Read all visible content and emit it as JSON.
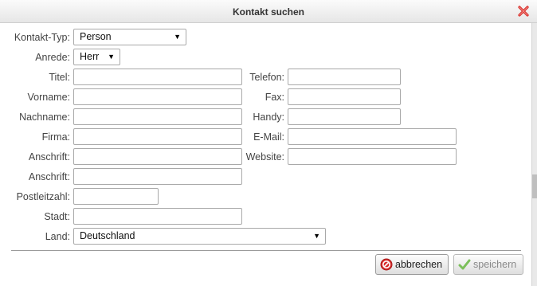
{
  "dialog": {
    "title": "Kontakt suchen"
  },
  "labels": {
    "kontakt_typ": "Kontakt-Typ:",
    "anrede": "Anrede:",
    "titel": "Titel:",
    "vorname": "Vorname:",
    "nachname": "Nachname:",
    "firma": "Firma:",
    "anschrift1": "Anschrift:",
    "anschrift2": "Anschrift:",
    "postleitzahl": "Postleitzahl:",
    "stadt": "Stadt:",
    "land": "Land:",
    "telefon": "Telefon:",
    "fax": "Fax:",
    "handy": "Handy:",
    "email": "E-Mail:",
    "website": "Website:"
  },
  "values": {
    "kontakt_typ": "Person",
    "anrede": "Herr",
    "land": "Deutschland",
    "titel": "",
    "vorname": "",
    "nachname": "",
    "firma": "",
    "anschrift1": "",
    "anschrift2": "",
    "postleitzahl": "",
    "stadt": "",
    "telefon": "",
    "fax": "",
    "handy": "",
    "email": "",
    "website": ""
  },
  "buttons": {
    "cancel": "abbrechen",
    "save": "speichern"
  },
  "icons": {
    "close": "close-icon",
    "cancel": "cancel-icon",
    "save": "checkmark-icon"
  },
  "colors": {
    "close_red": "#d9302b",
    "cancel_red": "#d92b2b",
    "save_green": "#7bbf5a"
  }
}
